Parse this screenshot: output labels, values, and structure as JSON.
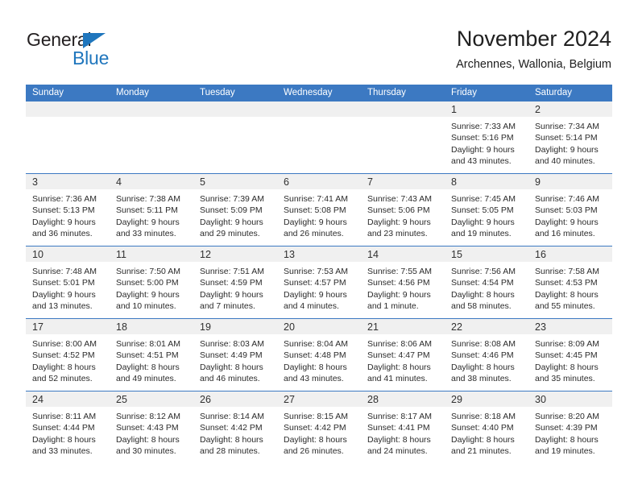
{
  "brand": {
    "name_part1": "General",
    "name_part2": "Blue",
    "triangle_color": "#1f76bd"
  },
  "header": {
    "title": "November 2024",
    "subtitle": "Archennes, Wallonia, Belgium",
    "accent_color": "#3c79c2"
  },
  "weekday_headers": [
    "Sunday",
    "Monday",
    "Tuesday",
    "Wednesday",
    "Thursday",
    "Friday",
    "Saturday"
  ],
  "weeks": [
    [
      {
        "day": "",
        "blank": true
      },
      {
        "day": "",
        "blank": true
      },
      {
        "day": "",
        "blank": true
      },
      {
        "day": "",
        "blank": true
      },
      {
        "day": "",
        "blank": true
      },
      {
        "day": "1",
        "sunrise": "Sunrise: 7:33 AM",
        "sunset": "Sunset: 5:16 PM",
        "daylight_line1": "Daylight: 9 hours",
        "daylight_line2": "and 43 minutes."
      },
      {
        "day": "2",
        "sunrise": "Sunrise: 7:34 AM",
        "sunset": "Sunset: 5:14 PM",
        "daylight_line1": "Daylight: 9 hours",
        "daylight_line2": "and 40 minutes."
      }
    ],
    [
      {
        "day": "3",
        "sunrise": "Sunrise: 7:36 AM",
        "sunset": "Sunset: 5:13 PM",
        "daylight_line1": "Daylight: 9 hours",
        "daylight_line2": "and 36 minutes."
      },
      {
        "day": "4",
        "sunrise": "Sunrise: 7:38 AM",
        "sunset": "Sunset: 5:11 PM",
        "daylight_line1": "Daylight: 9 hours",
        "daylight_line2": "and 33 minutes."
      },
      {
        "day": "5",
        "sunrise": "Sunrise: 7:39 AM",
        "sunset": "Sunset: 5:09 PM",
        "daylight_line1": "Daylight: 9 hours",
        "daylight_line2": "and 29 minutes."
      },
      {
        "day": "6",
        "sunrise": "Sunrise: 7:41 AM",
        "sunset": "Sunset: 5:08 PM",
        "daylight_line1": "Daylight: 9 hours",
        "daylight_line2": "and 26 minutes."
      },
      {
        "day": "7",
        "sunrise": "Sunrise: 7:43 AM",
        "sunset": "Sunset: 5:06 PM",
        "daylight_line1": "Daylight: 9 hours",
        "daylight_line2": "and 23 minutes."
      },
      {
        "day": "8",
        "sunrise": "Sunrise: 7:45 AM",
        "sunset": "Sunset: 5:05 PM",
        "daylight_line1": "Daylight: 9 hours",
        "daylight_line2": "and 19 minutes."
      },
      {
        "day": "9",
        "sunrise": "Sunrise: 7:46 AM",
        "sunset": "Sunset: 5:03 PM",
        "daylight_line1": "Daylight: 9 hours",
        "daylight_line2": "and 16 minutes."
      }
    ],
    [
      {
        "day": "10",
        "sunrise": "Sunrise: 7:48 AM",
        "sunset": "Sunset: 5:01 PM",
        "daylight_line1": "Daylight: 9 hours",
        "daylight_line2": "and 13 minutes."
      },
      {
        "day": "11",
        "sunrise": "Sunrise: 7:50 AM",
        "sunset": "Sunset: 5:00 PM",
        "daylight_line1": "Daylight: 9 hours",
        "daylight_line2": "and 10 minutes."
      },
      {
        "day": "12",
        "sunrise": "Sunrise: 7:51 AM",
        "sunset": "Sunset: 4:59 PM",
        "daylight_line1": "Daylight: 9 hours",
        "daylight_line2": "and 7 minutes."
      },
      {
        "day": "13",
        "sunrise": "Sunrise: 7:53 AM",
        "sunset": "Sunset: 4:57 PM",
        "daylight_line1": "Daylight: 9 hours",
        "daylight_line2": "and 4 minutes."
      },
      {
        "day": "14",
        "sunrise": "Sunrise: 7:55 AM",
        "sunset": "Sunset: 4:56 PM",
        "daylight_line1": "Daylight: 9 hours",
        "daylight_line2": "and 1 minute."
      },
      {
        "day": "15",
        "sunrise": "Sunrise: 7:56 AM",
        "sunset": "Sunset: 4:54 PM",
        "daylight_line1": "Daylight: 8 hours",
        "daylight_line2": "and 58 minutes."
      },
      {
        "day": "16",
        "sunrise": "Sunrise: 7:58 AM",
        "sunset": "Sunset: 4:53 PM",
        "daylight_line1": "Daylight: 8 hours",
        "daylight_line2": "and 55 minutes."
      }
    ],
    [
      {
        "day": "17",
        "sunrise": "Sunrise: 8:00 AM",
        "sunset": "Sunset: 4:52 PM",
        "daylight_line1": "Daylight: 8 hours",
        "daylight_line2": "and 52 minutes."
      },
      {
        "day": "18",
        "sunrise": "Sunrise: 8:01 AM",
        "sunset": "Sunset: 4:51 PM",
        "daylight_line1": "Daylight: 8 hours",
        "daylight_line2": "and 49 minutes."
      },
      {
        "day": "19",
        "sunrise": "Sunrise: 8:03 AM",
        "sunset": "Sunset: 4:49 PM",
        "daylight_line1": "Daylight: 8 hours",
        "daylight_line2": "and 46 minutes."
      },
      {
        "day": "20",
        "sunrise": "Sunrise: 8:04 AM",
        "sunset": "Sunset: 4:48 PM",
        "daylight_line1": "Daylight: 8 hours",
        "daylight_line2": "and 43 minutes."
      },
      {
        "day": "21",
        "sunrise": "Sunrise: 8:06 AM",
        "sunset": "Sunset: 4:47 PM",
        "daylight_line1": "Daylight: 8 hours",
        "daylight_line2": "and 41 minutes."
      },
      {
        "day": "22",
        "sunrise": "Sunrise: 8:08 AM",
        "sunset": "Sunset: 4:46 PM",
        "daylight_line1": "Daylight: 8 hours",
        "daylight_line2": "and 38 minutes."
      },
      {
        "day": "23",
        "sunrise": "Sunrise: 8:09 AM",
        "sunset": "Sunset: 4:45 PM",
        "daylight_line1": "Daylight: 8 hours",
        "daylight_line2": "and 35 minutes."
      }
    ],
    [
      {
        "day": "24",
        "sunrise": "Sunrise: 8:11 AM",
        "sunset": "Sunset: 4:44 PM",
        "daylight_line1": "Daylight: 8 hours",
        "daylight_line2": "and 33 minutes."
      },
      {
        "day": "25",
        "sunrise": "Sunrise: 8:12 AM",
        "sunset": "Sunset: 4:43 PM",
        "daylight_line1": "Daylight: 8 hours",
        "daylight_line2": "and 30 minutes."
      },
      {
        "day": "26",
        "sunrise": "Sunrise: 8:14 AM",
        "sunset": "Sunset: 4:42 PM",
        "daylight_line1": "Daylight: 8 hours",
        "daylight_line2": "and 28 minutes."
      },
      {
        "day": "27",
        "sunrise": "Sunrise: 8:15 AM",
        "sunset": "Sunset: 4:42 PM",
        "daylight_line1": "Daylight: 8 hours",
        "daylight_line2": "and 26 minutes."
      },
      {
        "day": "28",
        "sunrise": "Sunrise: 8:17 AM",
        "sunset": "Sunset: 4:41 PM",
        "daylight_line1": "Daylight: 8 hours",
        "daylight_line2": "and 24 minutes."
      },
      {
        "day": "29",
        "sunrise": "Sunrise: 8:18 AM",
        "sunset": "Sunset: 4:40 PM",
        "daylight_line1": "Daylight: 8 hours",
        "daylight_line2": "and 21 minutes."
      },
      {
        "day": "30",
        "sunrise": "Sunrise: 8:20 AM",
        "sunset": "Sunset: 4:39 PM",
        "daylight_line1": "Daylight: 8 hours",
        "daylight_line2": "and 19 minutes."
      }
    ]
  ]
}
